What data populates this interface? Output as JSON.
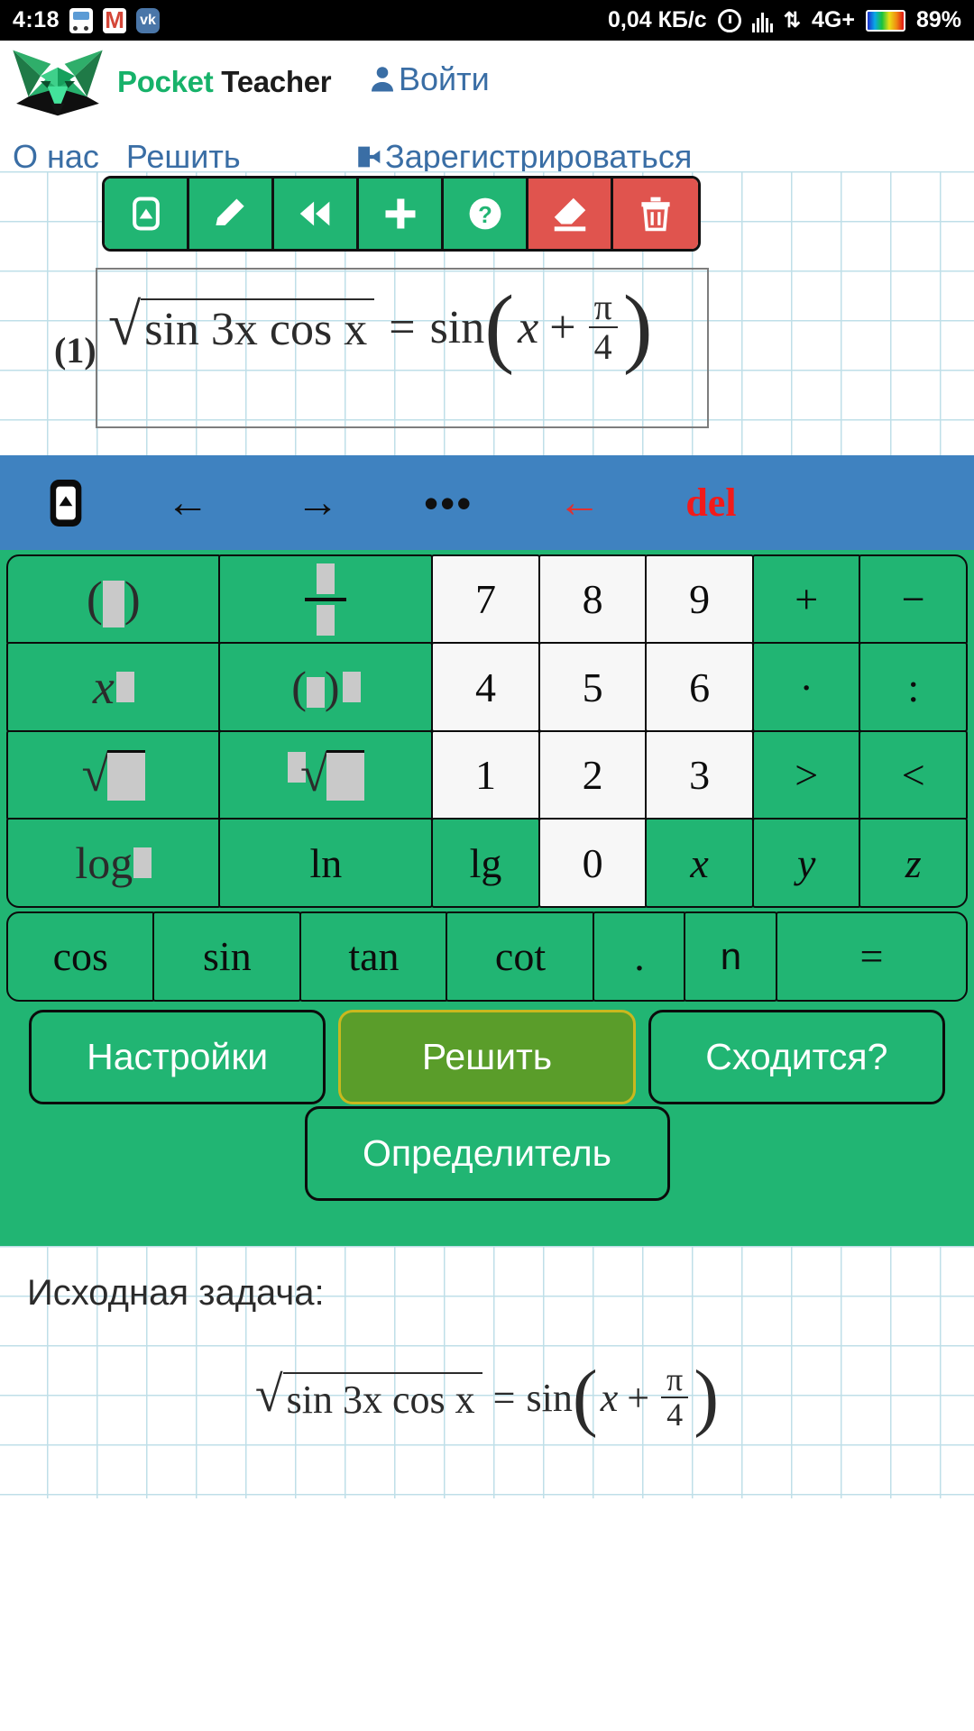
{
  "statusbar": {
    "time": "4:18",
    "icons": [
      "bus-icon",
      "gmail-icon",
      "vk-icon"
    ],
    "network_speed": "0,04 КБ/с",
    "alarm": "alarm-icon",
    "signal": "signal-bars-icon",
    "data_arrows": "⇅",
    "network_type": "4G+",
    "battery_percent": "89%"
  },
  "header": {
    "logo": "fox-logo",
    "brand_first": "Pocket ",
    "brand_second": "Teacher",
    "login": "Войти",
    "login_icon": "user-icon",
    "register": "Зарегистрироваться",
    "register_icon": "login-arrow-icon",
    "nav": [
      {
        "label": "О нас"
      },
      {
        "label": "Решить"
      }
    ]
  },
  "editor": {
    "toolbar": [
      {
        "name": "keyboard-button",
        "icon": "keyboard-icon",
        "style": "green"
      },
      {
        "name": "pencil-button",
        "icon": "pencil-icon",
        "style": "green"
      },
      {
        "name": "rewind-button",
        "icon": "rewind-icon",
        "style": "green"
      },
      {
        "name": "add-button",
        "icon": "plus-icon",
        "style": "green"
      },
      {
        "name": "help-button",
        "icon": "question-icon",
        "style": "green"
      },
      {
        "name": "erase-button",
        "icon": "eraser-icon",
        "style": "red"
      },
      {
        "name": "delete-button",
        "icon": "trash-icon",
        "style": "red"
      }
    ],
    "equation_number": "(1)",
    "equation": {
      "sqrt_of": "sin 3x cos x",
      "equals": "=",
      "rhs_fn": "sin",
      "rhs_arg_left": "x",
      "rhs_plus": "+",
      "rhs_frac_num": "π",
      "rhs_frac_den": "4"
    }
  },
  "navbar": {
    "keyboard_icon": "keyboard-icon",
    "left_arrow": "←",
    "right_arrow": "→",
    "more_dots": "•••",
    "backspace_arrow": "←",
    "delete_label": "del"
  },
  "keypad": {
    "rows": [
      [
        {
          "name": "parentheses-key",
          "label": "( ▯ )",
          "type": "green",
          "kind": "paren"
        },
        {
          "name": "fraction-key",
          "label": "▯/▯",
          "type": "green",
          "kind": "frac"
        },
        {
          "name": "digit-7-key",
          "label": "7",
          "type": "white",
          "kind": "text"
        },
        {
          "name": "digit-8-key",
          "label": "8",
          "type": "white",
          "kind": "text"
        },
        {
          "name": "digit-9-key",
          "label": "9",
          "type": "white",
          "kind": "text"
        },
        {
          "name": "plus-key",
          "label": "+",
          "type": "green",
          "kind": "text"
        },
        {
          "name": "minus-key",
          "label": "−",
          "type": "green",
          "kind": "text"
        }
      ],
      [
        {
          "name": "power-key",
          "label": "x▯",
          "type": "green",
          "kind": "pow"
        },
        {
          "name": "paren-power-key",
          "label": "(▯)▯",
          "type": "green",
          "kind": "parenpow"
        },
        {
          "name": "digit-4-key",
          "label": "4",
          "type": "white",
          "kind": "text"
        },
        {
          "name": "digit-5-key",
          "label": "5",
          "type": "white",
          "kind": "text"
        },
        {
          "name": "digit-6-key",
          "label": "6",
          "type": "white",
          "kind": "text"
        },
        {
          "name": "multiply-key",
          "label": "·",
          "type": "green",
          "kind": "text"
        },
        {
          "name": "divide-key",
          "label": ":",
          "type": "green",
          "kind": "text"
        }
      ],
      [
        {
          "name": "sqrt-key",
          "label": "√▯",
          "type": "green",
          "kind": "sqrt"
        },
        {
          "name": "nth-root-key",
          "label": "ⁿ√▯",
          "type": "green",
          "kind": "nroot"
        },
        {
          "name": "digit-1-key",
          "label": "1",
          "type": "white",
          "kind": "text"
        },
        {
          "name": "digit-2-key",
          "label": "2",
          "type": "white",
          "kind": "text"
        },
        {
          "name": "digit-3-key",
          "label": "3",
          "type": "white",
          "kind": "text"
        },
        {
          "name": "greater-than-key",
          "label": ">",
          "type": "green",
          "kind": "text"
        },
        {
          "name": "less-than-key",
          "label": "<",
          "type": "green",
          "kind": "text"
        }
      ],
      [
        {
          "name": "log-key",
          "label": "log▯",
          "type": "green",
          "kind": "log"
        },
        {
          "name": "ln-key",
          "label": "ln",
          "type": "green",
          "kind": "text"
        },
        {
          "name": "lg-key",
          "label": "lg",
          "type": "green",
          "kind": "text"
        },
        {
          "name": "digit-0-key",
          "label": "0",
          "type": "white",
          "kind": "text"
        },
        {
          "name": "var-x-key",
          "label": "x",
          "type": "green",
          "kind": "italic"
        },
        {
          "name": "var-y-key",
          "label": "y",
          "type": "green",
          "kind": "italic"
        },
        {
          "name": "var-z-key",
          "label": "z",
          "type": "green",
          "kind": "italic"
        }
      ],
      [
        {
          "name": "cos-key",
          "label": "cos",
          "type": "green",
          "kind": "text"
        },
        {
          "name": "sin-key",
          "label": "sin",
          "type": "green",
          "kind": "text"
        },
        {
          "name": "tan-key",
          "label": "tan",
          "type": "green",
          "kind": "text"
        },
        {
          "name": "cot-key",
          "label": "cot",
          "type": "green",
          "kind": "text"
        },
        {
          "name": "decimal-point-key",
          "label": ".",
          "type": "green",
          "kind": "text"
        },
        {
          "name": "var-n-key",
          "label": "n",
          "type": "green",
          "kind": "text"
        },
        {
          "name": "equals-key",
          "label": "=",
          "type": "green",
          "kind": "text"
        }
      ]
    ]
  },
  "actions": {
    "settings": "Настройки",
    "solve": "Решить",
    "converges": "Сходится?",
    "determinant": "Определитель"
  },
  "result": {
    "title": "Исходная задача:",
    "equation": {
      "sqrt_of": "sin 3x cos x",
      "equals": "=",
      "rhs_fn": "sin",
      "rhs_arg_left": "x",
      "rhs_plus": "+",
      "rhs_frac_num": "π",
      "rhs_frac_den": "4"
    }
  },
  "colors": {
    "green": "#21b573",
    "red": "#e0544e",
    "blue_bar": "#3f82c0",
    "link_blue": "#3a6ea5",
    "highlight": "#5a9d2a",
    "grid_line": "#bfdfe8"
  }
}
